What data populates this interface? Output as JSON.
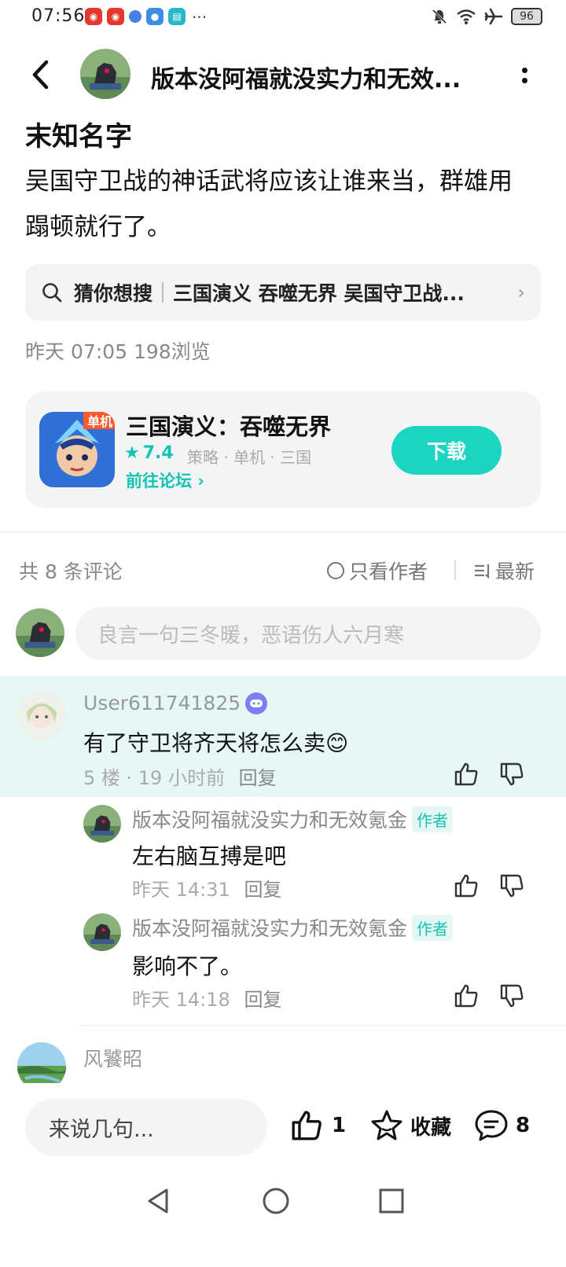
{
  "status": {
    "time": "07:56",
    "more": "···",
    "battery": "96"
  },
  "header": {
    "title": "版本没阿福就没实力和无效..."
  },
  "post": {
    "title": "末知名字",
    "body": "吴国守卫战的神话武将应该让谁来当，群雄用蹋顿就行了。",
    "meta": "昨天 07:05  198浏览"
  },
  "suggest": {
    "label": "猜你想搜",
    "text": "三国演义 吞噬无界 吴国守卫战..."
  },
  "app": {
    "name": "三国演义：吞噬无界",
    "rating": "7.4",
    "tags": "策略 · 单机 · 三国",
    "forum": "前往论坛 ›",
    "download": "下载",
    "icon_banner": "单机"
  },
  "comments_header": {
    "count": "共 8 条评论",
    "only_author": "只看作者",
    "sort": "最新"
  },
  "comment_input": {
    "placeholder": "良言一句三冬暖，恶语伤人六月寒"
  },
  "comments": [
    {
      "user": "User611741825",
      "text": "有了守卫将齐天将怎么卖",
      "emoji": "😊",
      "meta": "5 楼 · 19 小时前",
      "reply": "回复"
    }
  ],
  "replies": [
    {
      "user": "版本没阿福就没实力和无效氪金",
      "badge": "作者",
      "text": "左右脑互搏是吧",
      "time": "昨天 14:31",
      "reply": "回复"
    },
    {
      "user": "版本没阿福就没实力和无效氪金",
      "badge": "作者",
      "text": "影响不了。",
      "time": "昨天 14:18",
      "reply": "回复"
    }
  ],
  "next_comment": {
    "user": "风饕昭"
  },
  "bottom": {
    "input": "来说几句...",
    "likes": "1",
    "favorite": "收藏",
    "comments": "8"
  },
  "colors": {
    "accent": "#1bd4c1",
    "highlight_bg": "#e6f8f6",
    "panel_bg": "#f2f4f5"
  }
}
